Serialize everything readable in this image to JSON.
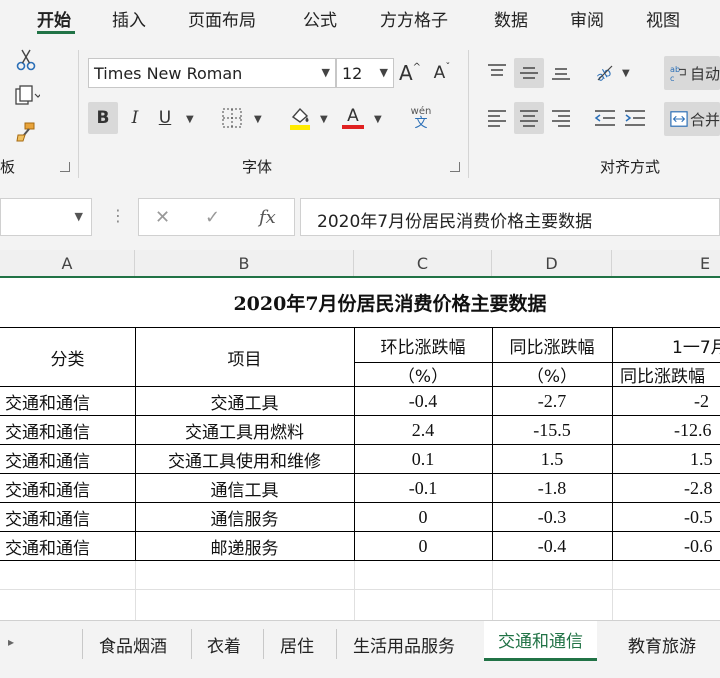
{
  "ribbon_tabs": [
    "开始",
    "插入",
    "页面布局",
    "公式",
    "方方格子",
    "数据",
    "审阅",
    "视图"
  ],
  "ribbon": {
    "clipboard_label": "板",
    "font_label": "字体",
    "align_label": "对齐方式",
    "font_name": "Times New Roman",
    "font_size": "12",
    "grow_font": "A",
    "shrink_font": "A",
    "bold": "B",
    "italic": "I",
    "underline": "U",
    "font_color_letter": "A",
    "phonetic_top": "wén",
    "phonetic_bottom": "文",
    "wrap_label": "自动",
    "merge_label": "合并",
    "underline_color": "#ffeb00",
    "font_color": "#e02020"
  },
  "formula_bar": {
    "name_box": "",
    "fx": "fx",
    "cancel": "✕",
    "enter": "✓",
    "content": "2020年7月份居民消费价格主要数据"
  },
  "columns": [
    "A",
    "B",
    "C",
    "D",
    "E"
  ],
  "sheet": {
    "title": "2020年7月份居民消费价格主要数据",
    "header": {
      "category": "分类",
      "item": "项目",
      "mom": "环比涨跌幅",
      "yoy": "同比涨跌幅",
      "ytd": "1一7月",
      "unit_c": "（%）",
      "unit_d": "（%）",
      "ytd_sub": "同比涨跌幅"
    },
    "rows": [
      {
        "category": "交通和通信",
        "item": "交通工具",
        "mom": "-0.4",
        "yoy": "-2.7",
        "ytd": "-2"
      },
      {
        "category": "交通和通信",
        "item": "交通工具用燃料",
        "mom": "2.4",
        "yoy": "-15.5",
        "ytd": "-12.6"
      },
      {
        "category": "交通和通信",
        "item": "交通工具使用和维修",
        "mom": "0.1",
        "yoy": "1.5",
        "ytd": "1.5"
      },
      {
        "category": "交通和通信",
        "item": "通信工具",
        "mom": "-0.1",
        "yoy": "-1.8",
        "ytd": "-2.8"
      },
      {
        "category": "交通和通信",
        "item": "通信服务",
        "mom": "0",
        "yoy": "-0.3",
        "ytd": "-0.5"
      },
      {
        "category": "交通和通信",
        "item": "邮递服务",
        "mom": "0",
        "yoy": "-0.4",
        "ytd": "-0.6"
      }
    ]
  },
  "sheet_tabs": [
    "食品烟酒",
    "衣着",
    "居住",
    "生活用品服务",
    "交通和通信",
    "教育旅游"
  ],
  "active_sheet": "交通和通信"
}
